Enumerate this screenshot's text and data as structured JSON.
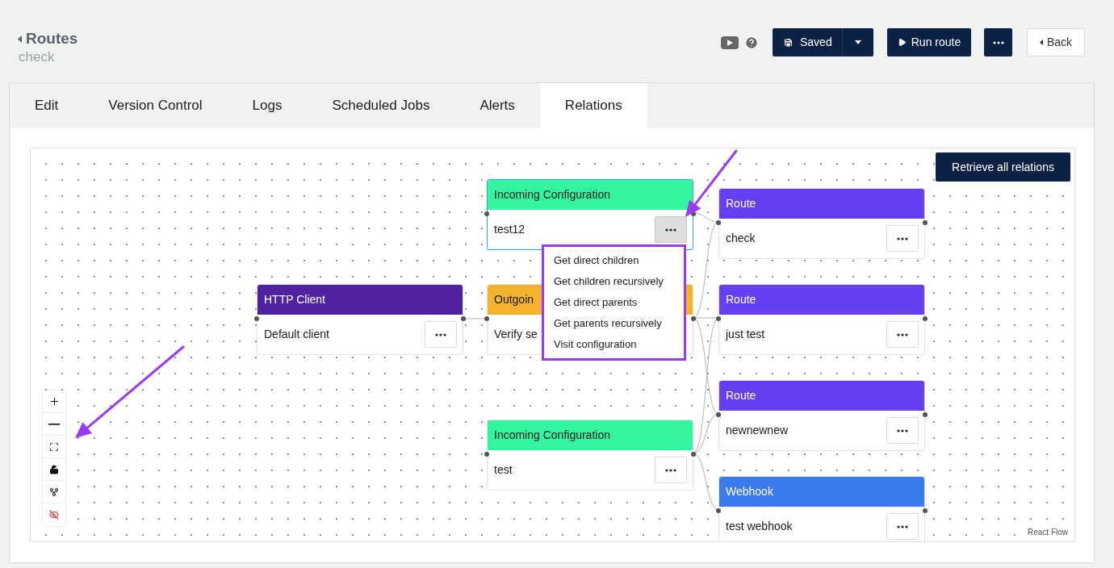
{
  "header": {
    "back_link": "Routes",
    "subtitle": "check"
  },
  "toolbar": {
    "save_button": "Saved",
    "run_button": "Run route",
    "back_button": "Back"
  },
  "tabs": [
    {
      "label": "Edit",
      "selected": false
    },
    {
      "label": "Version Control",
      "selected": false
    },
    {
      "label": "Logs",
      "selected": false
    },
    {
      "label": "Scheduled Jobs",
      "selected": false
    },
    {
      "label": "Alerts",
      "selected": false
    },
    {
      "label": "Relations",
      "selected": true
    }
  ],
  "canvas": {
    "retrieve_button": "Retrieve all relations",
    "nodes": [
      {
        "title": "Incoming Configuration",
        "name": "test12",
        "color": "#34f5a0",
        "selected": true,
        "menu_open": true
      },
      {
        "title": "HTTP Client",
        "name": "Default client",
        "color": "#4e22a0",
        "selected": false,
        "menu_open": false
      },
      {
        "title": "Outgoin",
        "name": "Verify se",
        "color": "#f4b22f",
        "selected": false
      },
      {
        "title": "Incoming Configuration",
        "name": "test",
        "color": "#34f5a0",
        "selected": false,
        "menu_open": false
      },
      {
        "title": "Route",
        "name": "check",
        "color": "#6640f0",
        "selected": false,
        "menu_open": false
      },
      {
        "title": "Route",
        "name": "just test",
        "color": "#6640f0",
        "selected": false,
        "menu_open": false
      },
      {
        "title": "Route",
        "name": "newnewnew",
        "color": "#6640f0",
        "selected": false,
        "menu_open": false
      },
      {
        "title": "Webhook",
        "name": "test webhook",
        "color": "#3b7bf0",
        "selected": false,
        "menu_open": false
      }
    ],
    "context_menu": [
      "Get direct children",
      "Get children recursively",
      "Get direct parents",
      "Get parents recursively",
      "Visit configuration"
    ],
    "attribution": "React Flow"
  }
}
